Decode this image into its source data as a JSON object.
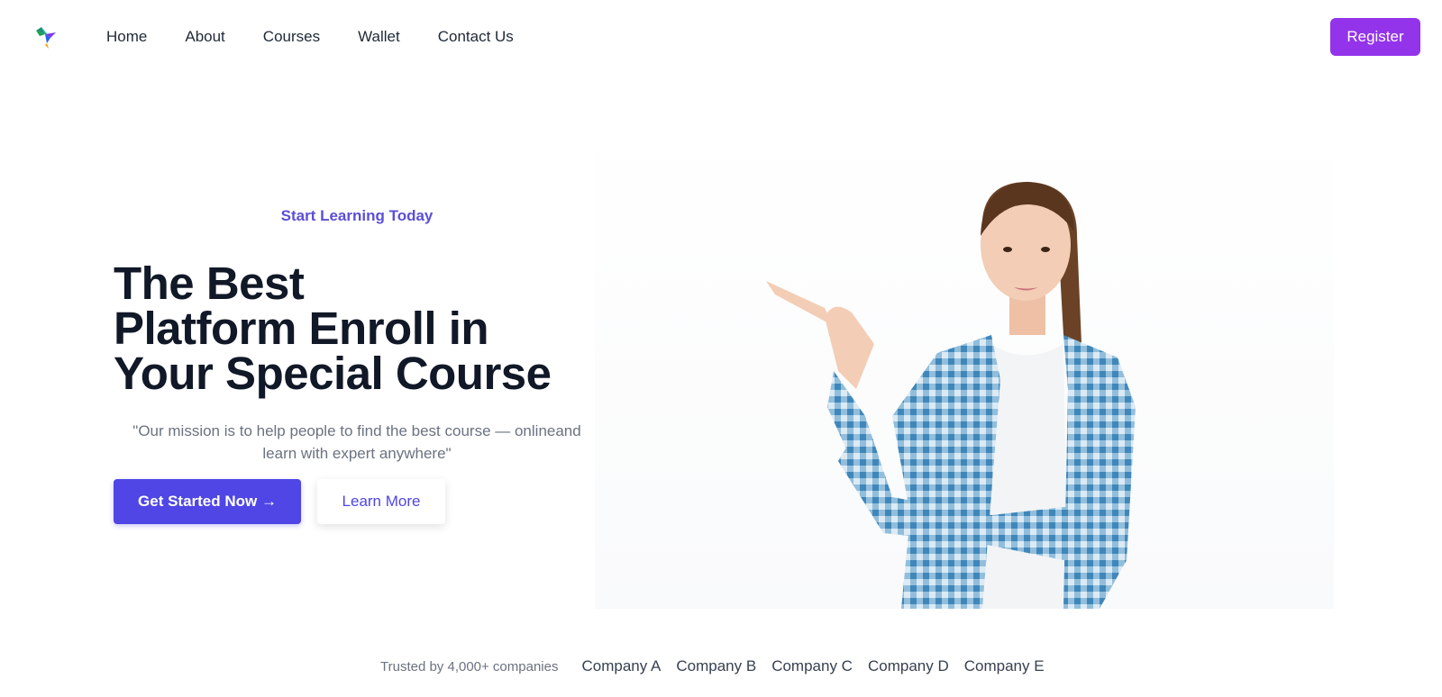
{
  "nav": {
    "logo_icon": "bird-logo-icon",
    "links": [
      "Home",
      "About",
      "Courses",
      "Wallet",
      "Contact Us"
    ],
    "register_label": "Register"
  },
  "hero": {
    "eyebrow": "Start Learning Today",
    "headline_lines": [
      "The Best",
      "Platform Enroll in",
      "Your Special Course"
    ],
    "mission_line1": "\"Our mission is to help people to find the best course — onlineand",
    "mission_line2": "learn with expert anywhere\"",
    "primary_cta": "Get Started Now →",
    "secondary_cta": "Learn More",
    "image_alt_icon": "woman-pointing-illustration"
  },
  "trusted": {
    "label": "Trusted by 4,000+ companies",
    "companies": [
      "Company A",
      "Company B",
      "Company C",
      "Company D",
      "Company E"
    ]
  },
  "colors": {
    "register_bg": "#9333ea",
    "primary": "#4f46e5",
    "eyebrow": "#5b4fd6",
    "headline": "#111827",
    "muted": "#6b7280"
  }
}
